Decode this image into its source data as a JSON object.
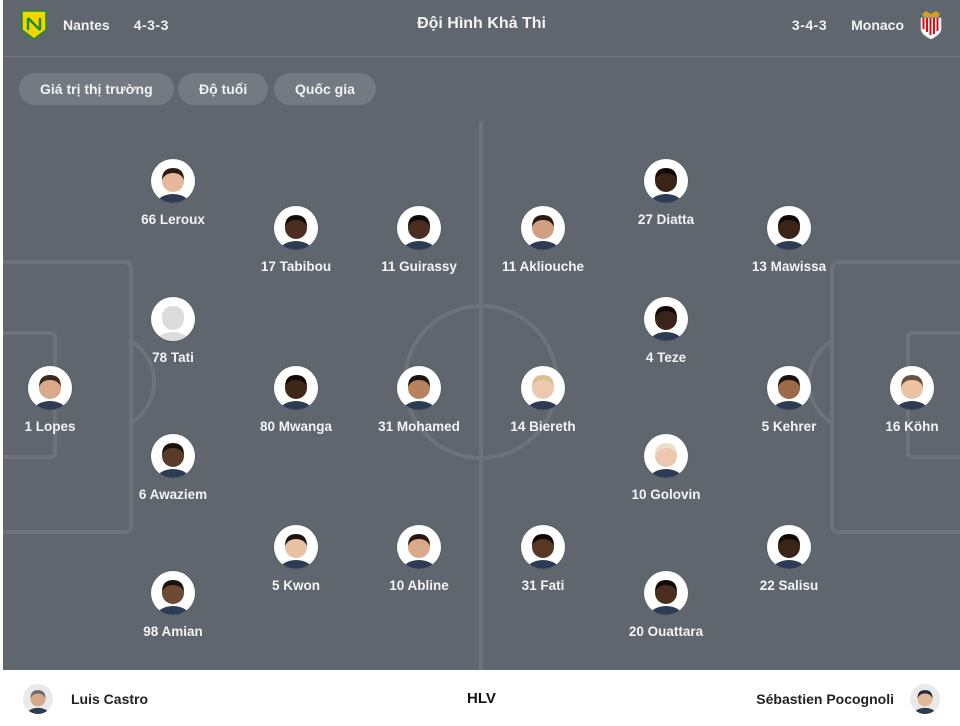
{
  "header": {
    "title": "Đội Hình Khả Thi",
    "home": {
      "name": "Nantes",
      "formation": "4-3-3",
      "crest_icon": "nantes-crest-icon",
      "crest_color": "#f2d600",
      "crest_accent": "#1f8a3a"
    },
    "away": {
      "name": "Monaco",
      "formation": "3-4-3",
      "crest_icon": "monaco-crest-icon",
      "crest_color": "#e30613"
    }
  },
  "filters": [
    {
      "label": "Giá trị thị trường"
    },
    {
      "label": "Độ tuổi"
    },
    {
      "label": "Quốc gia"
    }
  ],
  "colors": {
    "background": "#5f666e",
    "chip": "#737a82",
    "pitch_lines": "#6c737b",
    "text_light": "#f3f3f3"
  },
  "home_players": [
    {
      "label": "1 Lopes",
      "skin": "#d9a98a",
      "hair": "#3a2a20"
    },
    {
      "label": "66 Leroux",
      "skin": "#e5b89a",
      "hair": "#2a1a12"
    },
    {
      "label": "78 Tati",
      "skin": "#d9d9d9",
      "hair": "#d9d9d9",
      "placeholder": true
    },
    {
      "label": "6 Awaziem",
      "skin": "#5a3a28",
      "hair": "#1a120c"
    },
    {
      "label": "98 Amian",
      "skin": "#6e4a34",
      "hair": "#1a120c"
    },
    {
      "label": "17 Tabibou",
      "skin": "#4a2e20",
      "hair": "#140c08"
    },
    {
      "label": "80 Mwanga",
      "skin": "#3e2619",
      "hair": "#120a06"
    },
    {
      "label": "5 Kwon",
      "skin": "#e8c2a2",
      "hair": "#1a1410"
    },
    {
      "label": "11 Guirassy",
      "skin": "#4a2e20",
      "hair": "#120a06"
    },
    {
      "label": "31 Mohamed",
      "skin": "#b8825e",
      "hair": "#1a120c"
    },
    {
      "label": "10 Abline",
      "skin": "#d9a98a",
      "hair": "#241810"
    }
  ],
  "away_players": [
    {
      "label": "16 Köhn",
      "skin": "#ebc2a4",
      "hair": "#6a5240"
    },
    {
      "label": "13 Mawissa",
      "skin": "#3a2418",
      "hair": "#100806"
    },
    {
      "label": "5 Kehrer",
      "skin": "#9a6a4a",
      "hair": "#1a120c"
    },
    {
      "label": "22 Salisu",
      "skin": "#3a2418",
      "hair": "#100806"
    },
    {
      "label": "27 Diatta",
      "skin": "#3a2418",
      "hair": "#100806"
    },
    {
      "label": "4 Teze",
      "skin": "#3a2418",
      "hair": "#100806"
    },
    {
      "label": "10 Golovin",
      "skin": "#ecc8b0",
      "hair": "#e8e0c8"
    },
    {
      "label": "20 Ouattara",
      "skin": "#4a2e20",
      "hair": "#120a06"
    },
    {
      "label": "11 Akliouche",
      "skin": "#d0a080",
      "hair": "#2a1a12"
    },
    {
      "label": "14 Biereth",
      "skin": "#ecc8b0",
      "hair": "#d8c090"
    },
    {
      "label": "31 Fati",
      "skin": "#5a3826",
      "hair": "#100806"
    }
  ],
  "coaches": {
    "label": "HLV",
    "home": {
      "name": "Luis Castro",
      "skin": "#d6a88a",
      "hair": "#6a6a6a"
    },
    "away": {
      "name": "Sébastien Pocognoli",
      "skin": "#e2b699",
      "hair": "#2a2a3a"
    }
  }
}
